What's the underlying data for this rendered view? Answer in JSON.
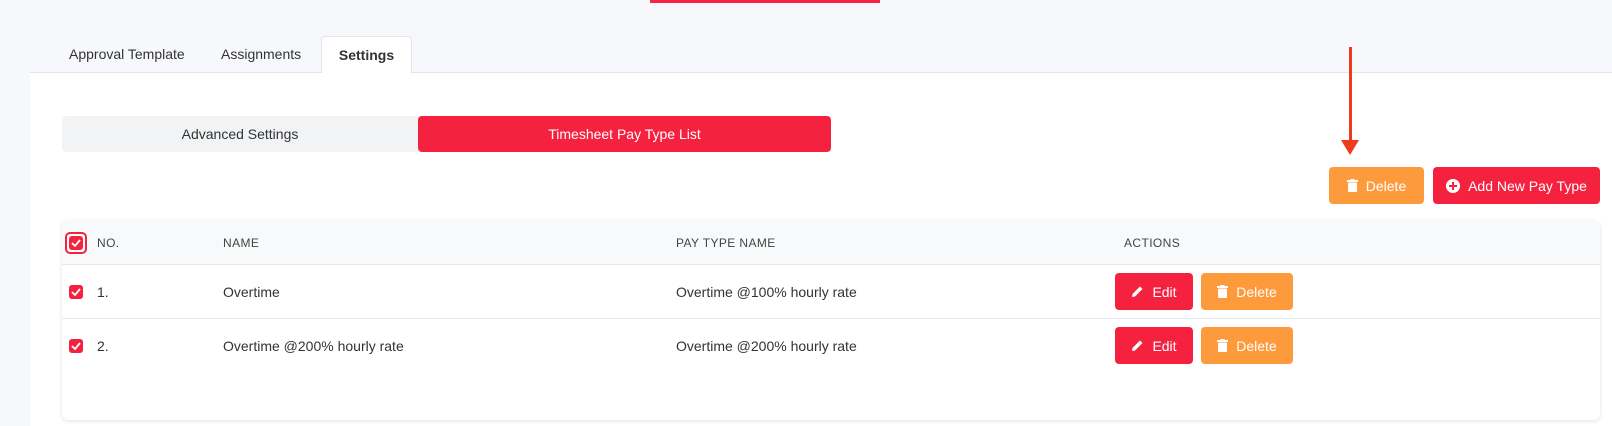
{
  "tabs": [
    {
      "label": "Approval Template"
    },
    {
      "label": "Assignments"
    },
    {
      "label": "Settings",
      "active": true
    }
  ],
  "segments": [
    {
      "label": "Advanced Settings"
    },
    {
      "label": "Timesheet Pay Type List",
      "active": true
    }
  ],
  "toolbar": {
    "delete_label": "Delete",
    "add_label": "Add New Pay Type"
  },
  "table": {
    "headers": {
      "no": "NO.",
      "name": "NAME",
      "pay_type_name": "PAY TYPE NAME",
      "actions": "ACTIONS"
    },
    "rows": [
      {
        "no": "1.",
        "name": "Overtime",
        "pay_type_name": "Overtime @100% hourly rate",
        "checked": true,
        "edit_label": "Edit",
        "delete_label": "Delete"
      },
      {
        "no": "2.",
        "name": "Overtime @200% hourly rate",
        "pay_type_name": "Overtime @200% hourly rate",
        "checked": true,
        "edit_label": "Edit",
        "delete_label": "Delete"
      }
    ]
  },
  "icons": {
    "delete": "trash-icon",
    "add": "plus-circle-icon",
    "edit": "pencil-icon",
    "check": "check-icon",
    "annotation": "down-arrow-annotation"
  },
  "colors": {
    "primary_red": "#f5223f",
    "orange": "#fd9a3c",
    "annotation_arrow": "#f03a1c"
  }
}
